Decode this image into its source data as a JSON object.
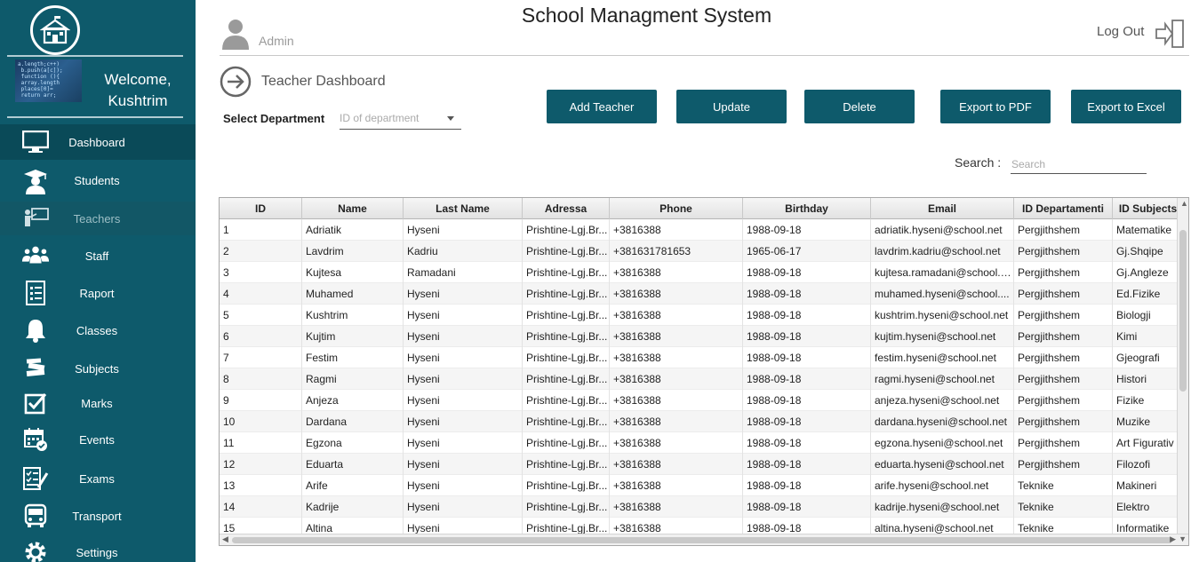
{
  "app": {
    "title": "School Managment System"
  },
  "header": {
    "user_label": "Admin",
    "logout_label": "Log Out"
  },
  "sidebar": {
    "welcome_line1": "Welcome,",
    "welcome_line2": "Kushtrim",
    "items": [
      {
        "label": "Dashboard",
        "icon": "monitor-icon"
      },
      {
        "label": "Students",
        "icon": "graduate-icon"
      },
      {
        "label": "Teachers",
        "icon": "teacher-board-icon"
      },
      {
        "label": "Staff",
        "icon": "group-icon"
      },
      {
        "label": "Raport",
        "icon": "report-icon"
      },
      {
        "label": "Classes",
        "icon": "bell-icon"
      },
      {
        "label": "Subjects",
        "icon": "books-icon"
      },
      {
        "label": "Marks",
        "icon": "checkbox-icon"
      },
      {
        "label": "Events",
        "icon": "calendar-icon"
      },
      {
        "label": "Exams",
        "icon": "exam-icon"
      },
      {
        "label": "Transport",
        "icon": "bus-icon"
      },
      {
        "label": "Settings",
        "icon": "gear-icon"
      }
    ]
  },
  "main": {
    "page_title": "Teacher Dashboard",
    "dept_label": "Select Department",
    "dept_placeholder": "ID of department",
    "buttons": {
      "add": "Add Teacher",
      "update": "Update",
      "delete": "Delete",
      "pdf": "Export to PDF",
      "excel": "Export to Excel"
    },
    "search_label": "Search :",
    "search_placeholder": "Search"
  },
  "table": {
    "columns": [
      "ID",
      "Name",
      "Last Name",
      "Adressa",
      "Phone",
      "Birthday",
      "Email",
      "ID Departamenti",
      "ID Subjects"
    ],
    "rows": [
      [
        "1",
        "Adriatik",
        "Hyseni",
        "Prishtine-Lgj.Br...",
        "+3816388",
        "1988-09-18",
        "adriatik.hyseni@school.net",
        "Pergjithshem",
        "Matematike"
      ],
      [
        "2",
        "Lavdrim",
        "Kadriu",
        "Prishtine-Lgj.Br...",
        "+381631781653",
        "1965-06-17",
        "lavdrim.kadriu@school.net",
        "Pergjithshem",
        "Gj.Shqipe"
      ],
      [
        "3",
        "Kujtesa",
        "Ramadani",
        "Prishtine-Lgj.Br...",
        "+3816388",
        "1988-09-18",
        "kujtesa.ramadani@school.net",
        "Pergjithshem",
        "Gj.Angleze"
      ],
      [
        "4",
        "Muhamed",
        "Hyseni",
        "Prishtine-Lgj.Br...",
        "+3816388",
        "1988-09-18",
        "muhamed.hyseni@school....",
        "Pergjithshem",
        "Ed.Fizike"
      ],
      [
        "5",
        "Kushtrim",
        "Hyseni",
        "Prishtine-Lgj.Br...",
        "+3816388",
        "1988-09-18",
        "kushtrim.hyseni@school.net",
        "Pergjithshem",
        "Biologji"
      ],
      [
        "6",
        "Kujtim",
        "Hyseni",
        "Prishtine-Lgj.Br...",
        "+3816388",
        "1988-09-18",
        "kujtim.hyseni@school.net",
        "Pergjithshem",
        "Kimi"
      ],
      [
        "7",
        "Festim",
        "Hyseni",
        "Prishtine-Lgj.Br...",
        "+3816388",
        "1988-09-18",
        "festim.hyseni@school.net",
        "Pergjithshem",
        "Gjeografi"
      ],
      [
        "8",
        "Ragmi",
        "Hyseni",
        "Prishtine-Lgj.Br...",
        "+3816388",
        "1988-09-18",
        "ragmi.hyseni@school.net",
        "Pergjithshem",
        "Histori"
      ],
      [
        "9",
        "Anjeza",
        "Hyseni",
        "Prishtine-Lgj.Br...",
        "+3816388",
        "1988-09-18",
        "anjeza.hyseni@school.net",
        "Pergjithshem",
        "Fizike"
      ],
      [
        "10",
        "Dardana",
        "Hyseni",
        "Prishtine-Lgj.Br...",
        "+3816388",
        "1988-09-18",
        "dardana.hyseni@school.net",
        "Pergjithshem",
        "Muzike"
      ],
      [
        "11",
        "Egzona",
        "Hyseni",
        "Prishtine-Lgj.Br...",
        "+3816388",
        "1988-09-18",
        "egzona.hyseni@school.net",
        "Pergjithshem",
        "Art Figurativ"
      ],
      [
        "12",
        "Eduarta",
        "Hyseni",
        "Prishtine-Lgj.Br...",
        "+3816388",
        "1988-09-18",
        "eduarta.hyseni@school.net",
        "Pergjithshem",
        "Filozofi"
      ],
      [
        "13",
        "Arife",
        "Hyseni",
        "Prishtine-Lgj.Br...",
        "+3816388",
        "1988-09-18",
        "arife.hyseni@school.net",
        "Teknike",
        "Makineri"
      ],
      [
        "14",
        "Kadrije",
        "Hyseni",
        "Prishtine-Lgj.Br...",
        "+3816388",
        "1988-09-18",
        "kadrije.hyseni@school.net",
        "Teknike",
        "Elektro"
      ],
      [
        "15",
        "Altina",
        "Hyseni",
        "Prishtine-Lgj.Br...",
        "+3816388",
        "1988-09-18",
        "altina.hyseni@school.net",
        "Teknike",
        "Informatike"
      ]
    ]
  },
  "colors": {
    "primary": "#0e5a6b",
    "sidebar_active": "#0a4a58"
  }
}
